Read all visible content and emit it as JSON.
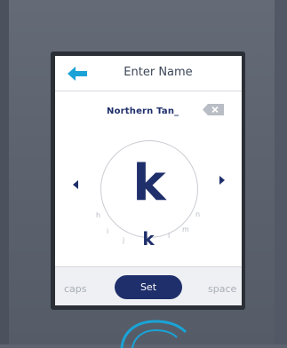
{
  "header": {
    "title": "Enter Name",
    "back_icon": "back-arrow-icon"
  },
  "entry": {
    "value": "Northern Tan_",
    "backspace_icon": "backspace-icon"
  },
  "picker": {
    "selected_letter": "k",
    "current_letter": "k",
    "ring_letters": [
      "h",
      "i",
      "j",
      "l",
      "m",
      "n"
    ],
    "nav_left_icon": "chevron-left-icon",
    "nav_right_icon": "chevron-right-icon"
  },
  "bottom_bar": {
    "caps_label": "caps",
    "set_label": "Set",
    "space_label": "space"
  },
  "colors": {
    "accent": "#1f2f6b",
    "back_arrow": "#1aa3d6",
    "background": "#5d6470"
  }
}
